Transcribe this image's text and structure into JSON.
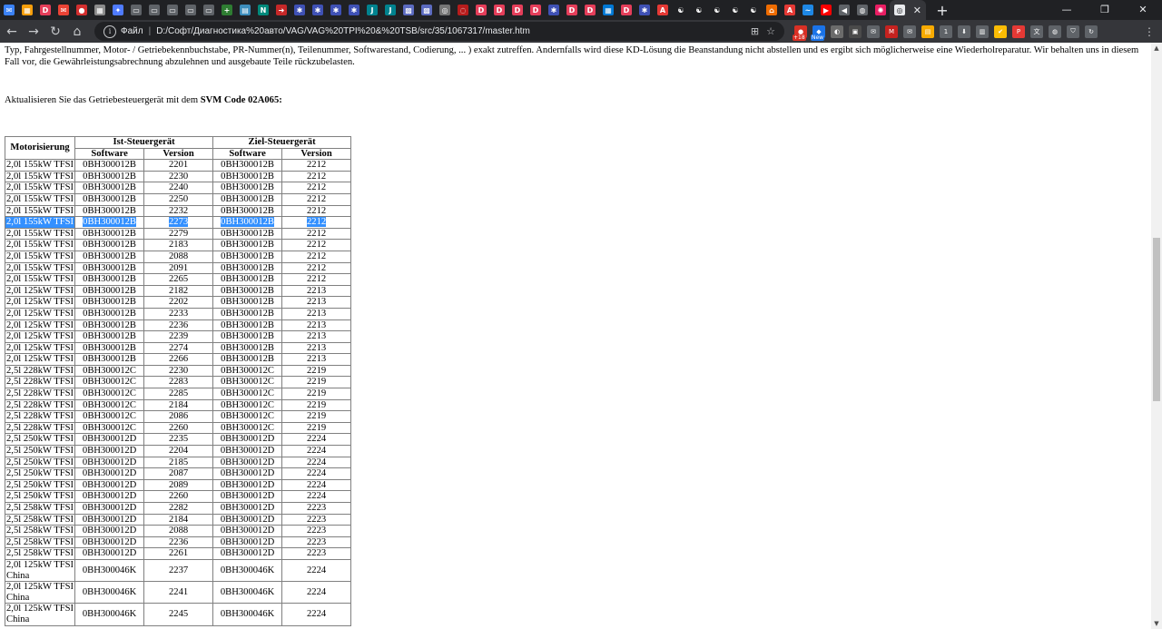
{
  "browser": {
    "tabs": [
      {
        "icon": "messenger-icon",
        "color": "#3b82f6",
        "glyph": "✉"
      },
      {
        "icon": "app-grid-icon",
        "color": "#f59e0b",
        "glyph": "▦"
      },
      {
        "icon": "d-icon",
        "color": "#e53e5a",
        "glyph": "D"
      },
      {
        "icon": "mail-icon",
        "color": "#ea4335",
        "glyph": "✉"
      },
      {
        "icon": "circle-icon",
        "color": "#d32f2f",
        "glyph": "●"
      },
      {
        "icon": "image-icon",
        "color": "#8b8b8b",
        "glyph": "▦"
      },
      {
        "icon": "star-icon",
        "color": "#4f7bff",
        "glyph": "✦"
      },
      {
        "icon": "wide-icon-1",
        "color": "#5f6368",
        "glyph": "▭"
      },
      {
        "icon": "wide-icon-2",
        "color": "#5f6368",
        "glyph": "▭"
      },
      {
        "icon": "wide-icon-3",
        "color": "#5f6368",
        "glyph": "▭"
      },
      {
        "icon": "wide-icon-4",
        "color": "#5f6368",
        "glyph": "▭"
      },
      {
        "icon": "wide-icon-5",
        "color": "#5f6368",
        "glyph": "▭"
      },
      {
        "icon": "plus-green-icon",
        "color": "#2e7d32",
        "glyph": "+"
      },
      {
        "icon": "chart-icon",
        "color": "#3c8dbc",
        "glyph": "▤"
      },
      {
        "icon": "n-icon",
        "color": "#00897b",
        "glyph": "N"
      },
      {
        "icon": "arrow-red-icon",
        "color": "#c62828",
        "glyph": "➜"
      },
      {
        "icon": "puzzle-icon-1",
        "color": "#3f51b5",
        "glyph": "✱"
      },
      {
        "icon": "puzzle-icon-2",
        "color": "#3f51b5",
        "glyph": "✱"
      },
      {
        "icon": "puzzle-icon-3",
        "color": "#3f51b5",
        "glyph": "✱"
      },
      {
        "icon": "puzzle-icon-4",
        "color": "#3f51b5",
        "glyph": "✱"
      },
      {
        "icon": "j-icon-1",
        "color": "#00838f",
        "glyph": "J"
      },
      {
        "icon": "j-icon-2",
        "color": "#00838f",
        "glyph": "J"
      },
      {
        "icon": "pattern-icon",
        "color": "#5c6bc0",
        "glyph": "▩"
      },
      {
        "icon": "pattern-icon-2",
        "color": "#5c6bc0",
        "glyph": "▩"
      },
      {
        "icon": "gear-circle-icon",
        "color": "#757575",
        "glyph": "◎"
      },
      {
        "icon": "spinner-icon",
        "color": "#b71c1c",
        "glyph": "◌"
      },
      {
        "icon": "d-icon-2",
        "color": "#e53e5a",
        "glyph": "D"
      },
      {
        "icon": "d-icon-3",
        "color": "#e53e5a",
        "glyph": "D"
      },
      {
        "icon": "d-icon-4",
        "color": "#e53e5a",
        "glyph": "D"
      },
      {
        "icon": "d-icon-5",
        "color": "#e53e5a",
        "glyph": "D"
      },
      {
        "icon": "puzzle-icon-5",
        "color": "#3f51b5",
        "glyph": "✱"
      },
      {
        "icon": "d-icon-6",
        "color": "#e53e5a",
        "glyph": "D"
      },
      {
        "icon": "d-icon-7",
        "color": "#e53e5a",
        "glyph": "D"
      },
      {
        "icon": "windows-icon",
        "color": "#0078d4",
        "glyph": "▦"
      },
      {
        "icon": "d-icon-8",
        "color": "#e53e5a",
        "glyph": "D"
      },
      {
        "icon": "puzzle-icon-6",
        "color": "#3f51b5",
        "glyph": "✱"
      },
      {
        "icon": "pdf-icon",
        "color": "#e53935",
        "glyph": "A"
      },
      {
        "icon": "yin-yang-icon-1",
        "color": "#202124",
        "glyph": "☯"
      },
      {
        "icon": "yin-yang-icon-2",
        "color": "#202124",
        "glyph": "☯"
      },
      {
        "icon": "yin-yang-icon-3",
        "color": "#202124",
        "glyph": "☯"
      },
      {
        "icon": "yin-yang-icon-4",
        "color": "#202124",
        "glyph": "☯"
      },
      {
        "icon": "yin-yang-icon-5",
        "color": "#202124",
        "glyph": "☯"
      },
      {
        "icon": "house-icon",
        "color": "#ef6c00",
        "glyph": "⌂"
      },
      {
        "icon": "pdf-icon-2",
        "color": "#e53935",
        "glyph": "A"
      },
      {
        "icon": "blue-wave-icon",
        "color": "#1e88e5",
        "glyph": "~"
      },
      {
        "icon": "youtube-icon",
        "color": "#ff0000",
        "glyph": "▶"
      },
      {
        "icon": "speaker-icon",
        "color": "#5f6368",
        "glyph": "◀"
      },
      {
        "icon": "globe-icon",
        "color": "#5f6368",
        "glyph": "◍"
      },
      {
        "icon": "pinwheel-icon",
        "color": "#e91e63",
        "glyph": "✺"
      }
    ],
    "active_tab_close": "✕",
    "new_tab": "+",
    "window_controls": [
      "—",
      "❐",
      "✕"
    ],
    "nav": {
      "back": "←",
      "forward": "→",
      "reload": "↻",
      "home": "⌂"
    },
    "address": {
      "info_glyph": "i",
      "scheme_label": "Файл",
      "separator": "|",
      "url": "D:/Софт/Диагностика%20авто/VAG/VAG%20TPI%20&%20TSB/src/35/1067317/master.htm",
      "translate_glyph": "⊞",
      "bookmark_glyph": "☆"
    },
    "extensions": [
      {
        "icon": "ext-red-badge-icon",
        "color": "#d93025",
        "glyph": "●",
        "badge": "+18",
        "badge_color": "red"
      },
      {
        "icon": "ext-new-icon",
        "color": "#1a73e8",
        "glyph": "◆",
        "badge": "New",
        "badge_color": "blue"
      },
      {
        "icon": "ext-ghost-icon",
        "color": "#6b6b6b",
        "glyph": "◐"
      },
      {
        "icon": "ext-box-icon",
        "color": "#4a4a4a",
        "glyph": "▣"
      },
      {
        "icon": "ext-mail-icon",
        "color": "#5f6368",
        "glyph": "✉"
      },
      {
        "icon": "ext-gmail-icon",
        "color": "#c5221f",
        "glyph": "M"
      },
      {
        "icon": "ext-envelope-icon",
        "color": "#5f6368",
        "glyph": "✉"
      },
      {
        "icon": "ext-note-icon",
        "color": "#f9ab00",
        "glyph": "▤"
      },
      {
        "icon": "ext-one-icon",
        "color": "#5f6368",
        "glyph": "1"
      },
      {
        "icon": "ext-download-icon",
        "color": "#5f6368",
        "glyph": "⬇"
      },
      {
        "icon": "ext-clipboard-icon",
        "color": "#5f6368",
        "glyph": "▥"
      },
      {
        "icon": "ext-stamp-icon",
        "color": "#fbbc04",
        "glyph": "✔"
      },
      {
        "icon": "ext-p-icon",
        "color": "#e53935",
        "glyph": "P"
      },
      {
        "icon": "ext-translate-icon",
        "color": "#5f6368",
        "glyph": "文"
      },
      {
        "icon": "ext-globe-icon",
        "color": "#5f6368",
        "glyph": "◍"
      },
      {
        "icon": "ext-shield-icon",
        "color": "#5f6368",
        "glyph": "⛉"
      },
      {
        "icon": "ext-reload-icon",
        "color": "#5f6368",
        "glyph": "↻"
      }
    ],
    "menu_glyph": "⋮"
  },
  "page": {
    "paragraph": "Typ, Fahrgestellnummer, Motor- / Getriebekennbuchstabe, PR-Nummer(n), Teilenummer, Softwarestand, Codierung, ... ) exakt zutreffen. Andernfalls wird diese KD-Lösung die Beanstandung nicht abstellen und es ergibt sich möglicherweise eine Wiederholreparatur. Wir behalten uns in diesem Fall vor, die Gewährleistungsabrechnung abzulehnen und ausgebaute Teile rückzubelasten.",
    "instruction_prefix": "Aktualisieren Sie das Getriebesteuergerät mit dem ",
    "instruction_bold": "SVM Code 02A065:",
    "table": {
      "header_engine": "Motorisierung",
      "header_ist": "Ist-Steuergerät",
      "header_ziel": "Ziel-Steuergerät",
      "sub_software": "Software",
      "sub_version": "Version",
      "selected_row": 5,
      "rows": [
        [
          "2,0l 155kW TFSI",
          "0BH300012B",
          "2201",
          "0BH300012B",
          "2212"
        ],
        [
          "2,0l 155kW TFSI",
          "0BH300012B",
          "2230",
          "0BH300012B",
          "2212"
        ],
        [
          "2,0l 155kW TFSI",
          "0BH300012B",
          "2240",
          "0BH300012B",
          "2212"
        ],
        [
          "2,0l 155kW TFSI",
          "0BH300012B",
          "2250",
          "0BH300012B",
          "2212"
        ],
        [
          "2,0l 155kW TFSI",
          "0BH300012B",
          "2232",
          "0BH300012B",
          "2212"
        ],
        [
          "2,0l 155kW TFSI",
          "0BH300012B",
          "2273",
          "0BH300012B",
          "2212"
        ],
        [
          "2,0l 155kW TFSI",
          "0BH300012B",
          "2279",
          "0BH300012B",
          "2212"
        ],
        [
          "2,0l 155kW TFSI",
          "0BH300012B",
          "2183",
          "0BH300012B",
          "2212"
        ],
        [
          "2,0l 155kW TFSI",
          "0BH300012B",
          "2088",
          "0BH300012B",
          "2212"
        ],
        [
          "2,0l 155kW TFSI",
          "0BH300012B",
          "2091",
          "0BH300012B",
          "2212"
        ],
        [
          "2,0l 155kW TFSI",
          "0BH300012B",
          "2265",
          "0BH300012B",
          "2212"
        ],
        [
          "2,0l 125kW TFSI",
          "0BH300012B",
          "2182",
          "0BH300012B",
          "2213"
        ],
        [
          "2,0l 125kW TFSI",
          "0BH300012B",
          "2202",
          "0BH300012B",
          "2213"
        ],
        [
          "2,0l 125kW TFSI",
          "0BH300012B",
          "2233",
          "0BH300012B",
          "2213"
        ],
        [
          "2,0l 125kW TFSI",
          "0BH300012B",
          "2236",
          "0BH300012B",
          "2213"
        ],
        [
          "2,0l 125kW TFSI",
          "0BH300012B",
          "2239",
          "0BH300012B",
          "2213"
        ],
        [
          "2,0l 125kW TFSI",
          "0BH300012B",
          "2274",
          "0BH300012B",
          "2213"
        ],
        [
          "2,0l 125kW TFSI",
          "0BH300012B",
          "2266",
          "0BH300012B",
          "2213"
        ],
        [
          "2,5l 228kW TFSI",
          "0BH300012C",
          "2230",
          "0BH300012C",
          "2219"
        ],
        [
          "2,5l 228kW TFSI",
          "0BH300012C",
          "2283",
          "0BH300012C",
          "2219"
        ],
        [
          "2,5l 228kW TFSI",
          "0BH300012C",
          "2285",
          "0BH300012C",
          "2219"
        ],
        [
          "2,5l 228kW TFSI",
          "0BH300012C",
          "2184",
          "0BH300012C",
          "2219"
        ],
        [
          "2,5l 228kW TFSI",
          "0BH300012C",
          "2086",
          "0BH300012C",
          "2219"
        ],
        [
          "2,5l 228kW TFSI",
          "0BH300012C",
          "2260",
          "0BH300012C",
          "2219"
        ],
        [
          "2,5l 250kW TFSI",
          "0BH300012D",
          "2235",
          "0BH300012D",
          "2224"
        ],
        [
          "2,5l 250kW TFSI",
          "0BH300012D",
          "2204",
          "0BH300012D",
          "2224"
        ],
        [
          "2,5l 250kW TFSI",
          "0BH300012D",
          "2185",
          "0BH300012D",
          "2224"
        ],
        [
          "2,5l 250kW TFSI",
          "0BH300012D",
          "2087",
          "0BH300012D",
          "2224"
        ],
        [
          "2,5l 250kW TFSI",
          "0BH300012D",
          "2089",
          "0BH300012D",
          "2224"
        ],
        [
          "2,5l 250kW TFSI",
          "0BH300012D",
          "2260",
          "0BH300012D",
          "2224"
        ],
        [
          "2,5l 258kW TFSI",
          "0BH300012D",
          "2282",
          "0BH300012D",
          "2223"
        ],
        [
          "2,5l 258kW TFSI",
          "0BH300012D",
          "2184",
          "0BH300012D",
          "2223"
        ],
        [
          "2,5l 258kW TFSI",
          "0BH300012D",
          "2088",
          "0BH300012D",
          "2223"
        ],
        [
          "2,5l 258kW TFSI",
          "0BH300012D",
          "2236",
          "0BH300012D",
          "2223"
        ],
        [
          "2,5l 258kW TFSI",
          "0BH300012D",
          "2261",
          "0BH300012D",
          "2223"
        ],
        [
          "2,0l 125kW TFSI China",
          "0BH300046K",
          "2237",
          "0BH300046K",
          "2224"
        ],
        [
          "2,0l 125kW TFSI China",
          "0BH300046K",
          "2241",
          "0BH300046K",
          "2224"
        ],
        [
          "2,0l 125kW TFSI China",
          "0BH300046K",
          "2245",
          "0BH300046K",
          "2224"
        ]
      ]
    }
  },
  "scrollbar": {
    "up": "▲",
    "down": "▼"
  }
}
